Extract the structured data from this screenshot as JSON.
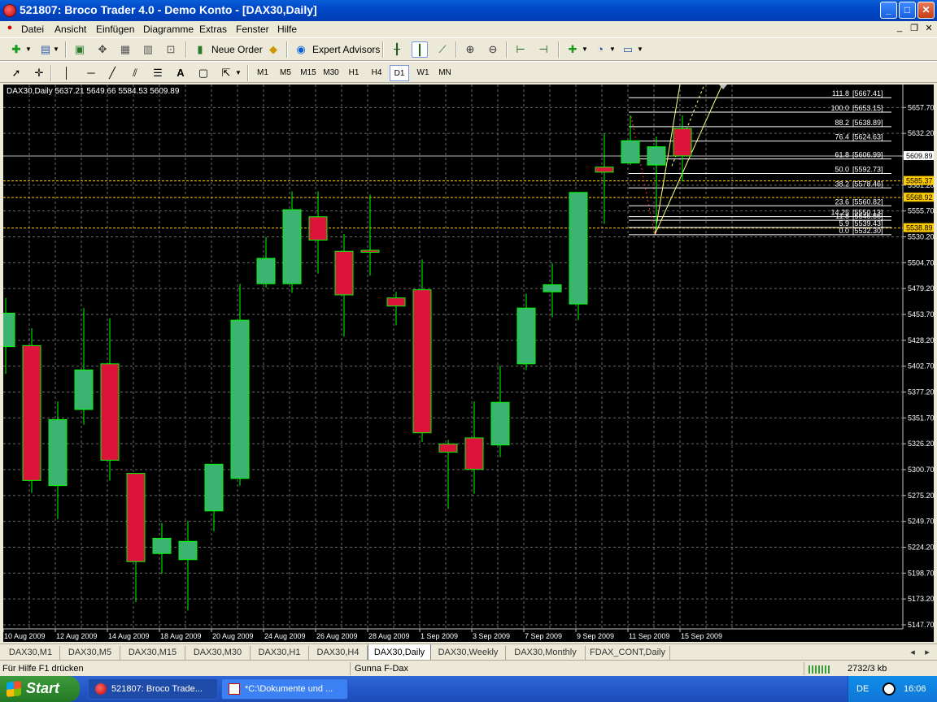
{
  "window": {
    "title": "521807: Broco Trader 4.0 - Demo Konto - [DAX30,Daily]"
  },
  "menu": [
    "Datei",
    "Ansicht",
    "Einfügen",
    "Diagramme",
    "Extras",
    "Fenster",
    "Hilfe"
  ],
  "toolbar": {
    "new_order": "Neue Order",
    "expert_advisors": "Expert Advisors",
    "timeframes": [
      "M1",
      "M5",
      "M15",
      "M30",
      "H1",
      "H4",
      "D1",
      "W1",
      "MN"
    ],
    "active_timeframe": "D1"
  },
  "chart_data": {
    "type": "candlestick",
    "header": "DAX30,Daily  5637.21 5649.66 5584.53 5609.89",
    "ylim": [
      5147.7,
      5670.0
    ],
    "price_labels": [
      "5657.70",
      "5632.20",
      "5609.89",
      "5581.20",
      "5555.70",
      "5530.20",
      "5504.70",
      "5479.20",
      "5453.70",
      "5428.20",
      "5402.70",
      "5377.20",
      "5351.70",
      "5326.20",
      "5300.70",
      "5275.20",
      "5249.70",
      "5224.20",
      "5198.70",
      "5173.20",
      "5147.70"
    ],
    "price_ticks": [
      5657.7,
      5632.2,
      5581.2,
      5555.7,
      5530.2,
      5504.7,
      5479.2,
      5453.7,
      5428.2,
      5402.7,
      5377.2,
      5351.7,
      5326.2,
      5300.7,
      5275.2,
      5249.7,
      5224.2,
      5198.7,
      5173.2,
      5147.7
    ],
    "date_labels": [
      "10 Aug 2009",
      "12 Aug 2009",
      "14 Aug 2009",
      "18 Aug 2009",
      "20 Aug 2009",
      "24 Aug 2009",
      "26 Aug 2009",
      "28 Aug 2009",
      "1 Sep 2009",
      "3 Sep 2009",
      "7 Sep 2009",
      "9 Sep 2009",
      "11 Sep 2009",
      "15 Sep 2009"
    ],
    "current_price": 5609.89,
    "current_price_label": "5609.89",
    "bid_ask_labels": [
      {
        "value": 5585.37,
        "label": "5585.37"
      },
      {
        "value": 5568.92,
        "label": "5568.92"
      },
      {
        "value": 5538.89,
        "label": "5538.89"
      }
    ],
    "candles": [
      {
        "o": 5422,
        "h": 5470,
        "l": 5395,
        "c": 5455
      },
      {
        "o": 5423,
        "h": 5440,
        "l": 5278,
        "c": 5290
      },
      {
        "o": 5285,
        "h": 5368,
        "l": 5252,
        "c": 5350
      },
      {
        "o": 5360,
        "h": 5460,
        "l": 5345,
        "c": 5399
      },
      {
        "o": 5405,
        "h": 5450,
        "l": 5290,
        "c": 5310
      },
      {
        "o": 5297,
        "h": 5297,
        "l": 5170,
        "c": 5210
      },
      {
        "o": 5218,
        "h": 5248,
        "l": 5198,
        "c": 5233
      },
      {
        "o": 5212,
        "h": 5250,
        "l": 5162,
        "c": 5230
      },
      {
        "o": 5260,
        "h": 5305,
        "l": 5240,
        "c": 5306
      },
      {
        "o": 5292,
        "h": 5484,
        "l": 5285,
        "c": 5448
      },
      {
        "o": 5484,
        "h": 5530,
        "l": 5480,
        "c": 5509
      },
      {
        "o": 5484,
        "h": 5575,
        "l": 5475,
        "c": 5557
      },
      {
        "o": 5550,
        "h": 5575,
        "l": 5494,
        "c": 5527
      },
      {
        "o": 5516,
        "h": 5533,
        "l": 5432,
        "c": 5473
      },
      {
        "o": 5517,
        "h": 5572,
        "l": 5492,
        "c": 5515
      },
      {
        "o": 5470,
        "h": 5476,
        "l": 5443,
        "c": 5462
      },
      {
        "o": 5478,
        "h": 5508,
        "l": 5328,
        "c": 5337
      },
      {
        "o": 5326,
        "h": 5330,
        "l": 5262,
        "c": 5318
      },
      {
        "o": 5332,
        "h": 5368,
        "l": 5277,
        "c": 5301
      },
      {
        "o": 5325,
        "h": 5403,
        "l": 5313,
        "c": 5367
      },
      {
        "o": 5405,
        "h": 5474,
        "l": 5399,
        "c": 5460
      },
      {
        "o": 5476,
        "h": 5504,
        "l": 5451,
        "c": 5483
      },
      {
        "o": 5464,
        "h": 5574,
        "l": 5448,
        "c": 5574
      },
      {
        "o": 5599,
        "h": 5632,
        "l": 5543,
        "c": 5594
      },
      {
        "o": 5603,
        "h": 5650,
        "l": 5601,
        "c": 5625
      },
      {
        "o": 5601,
        "h": 5629,
        "l": 5538,
        "c": 5619
      },
      {
        "o": 5637,
        "h": 5650,
        "l": 5585,
        "c": 5610
      }
    ],
    "fibonacci": [
      {
        "level": "111.8",
        "value": 5667.41,
        "label": "[5667.41]"
      },
      {
        "level": "100.0",
        "value": 5653.15,
        "label": "[5653.15]"
      },
      {
        "level": "88.2",
        "value": 5638.89,
        "label": "[5638.89]"
      },
      {
        "level": "76.4",
        "value": 5624.63,
        "label": "[5624.63]"
      },
      {
        "level": "61.8",
        "value": 5606.99,
        "label": "[5606.99]"
      },
      {
        "level": "50.0",
        "value": 5592.73,
        "label": "[5592.73]"
      },
      {
        "level": "38.2",
        "value": 5578.46,
        "label": "[5578.46]"
      },
      {
        "level": "23.6",
        "value": 5560.82,
        "label": "[5560.82]"
      },
      {
        "level": "14.25",
        "value": 5550.13,
        "label": "[5550.13]"
      },
      {
        "level": "11.8",
        "value": 5546.56,
        "label": "[5546.56]"
      },
      {
        "level": "5.9",
        "value": 5539.43,
        "label": "[5539.43]"
      },
      {
        "level": "0.0",
        "value": 5532.3,
        "label": "[5532.30]"
      }
    ],
    "colors": {
      "bull": "#3cb371",
      "bear": "#dc143c",
      "wick": "#00ff00",
      "grid": "#6b6b6b",
      "axis_text": "#ffffff",
      "fib": "#ffffff",
      "trend": "#ffff80",
      "bid_line": "#ffcc00"
    }
  },
  "tabs": {
    "items": [
      "DAX30,M1",
      "DAX30,M5",
      "DAX30,M15",
      "DAX30,M30",
      "DAX30,H1",
      "DAX30,H4",
      "DAX30,Daily",
      "DAX30,Weekly",
      "DAX30,Monthly",
      "FDAX_CONT,Daily"
    ],
    "active": "DAX30,Daily"
  },
  "status": {
    "help": "Für Hilfe F1 drücken",
    "profile": "Gunna F-Dax",
    "traffic": "2732/3 kb"
  },
  "taskbar": {
    "start": "Start",
    "tasks": [
      "521807: Broco Trade...",
      "*C:\\Dokumente und ..."
    ],
    "lang": "DE",
    "clock": "16:06"
  }
}
